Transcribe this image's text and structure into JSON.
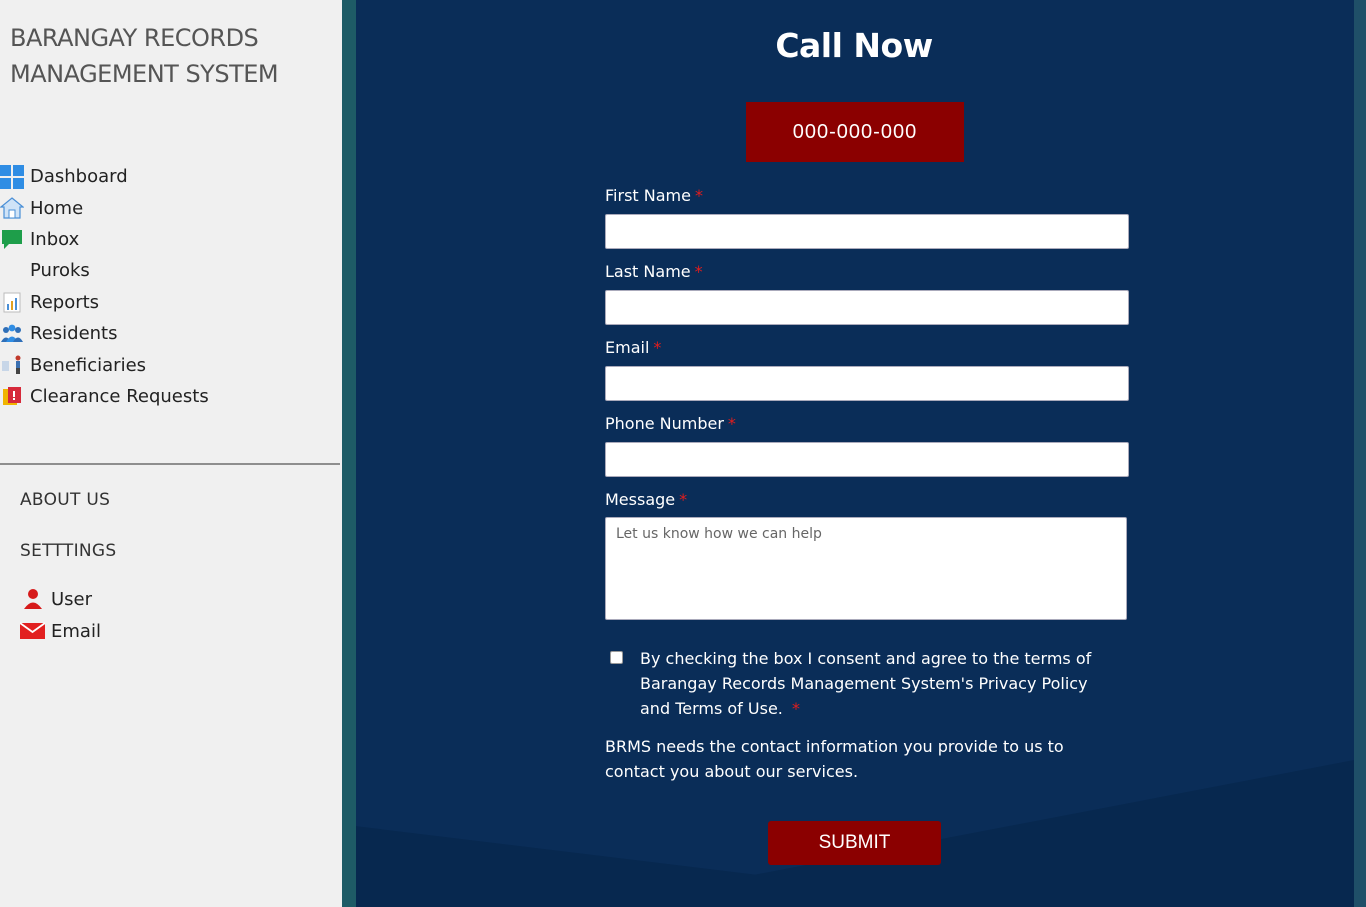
{
  "sidebar": {
    "brand": "BARANGAY RECORDS MANAGEMENT SYSTEM",
    "nav": [
      {
        "label": "Dashboard",
        "icon": "dashboard-icon"
      },
      {
        "label": "Home",
        "icon": "home-icon"
      },
      {
        "label": "Inbox",
        "icon": "chat-icon"
      },
      {
        "label": "Puroks",
        "icon": ""
      },
      {
        "label": "Reports",
        "icon": "reports-icon"
      },
      {
        "label": "Residents",
        "icon": "residents-icon"
      },
      {
        "label": "Beneficiaries",
        "icon": "beneficiaries-icon"
      },
      {
        "label": "Clearance Requests",
        "icon": "clearance-icon"
      }
    ],
    "about": "ABOUT US",
    "settings": "SETTTINGS",
    "sub_items": [
      {
        "label": "User",
        "icon": "user-icon"
      },
      {
        "label": "Email",
        "icon": "email-icon"
      }
    ]
  },
  "main": {
    "title": "Call Now",
    "phone": "000-000-000",
    "fields": [
      {
        "label": "First Name",
        "required": "*",
        "value": ""
      },
      {
        "label": "Last Name",
        "required": "*",
        "value": ""
      },
      {
        "label": "Email",
        "required": "*",
        "value": ""
      },
      {
        "label": "Phone Number",
        "required": "*",
        "value": ""
      }
    ],
    "message": {
      "label": "Message",
      "required": "*",
      "placeholder": "Let us know how we can help"
    },
    "consent": {
      "text": "By checking the box I consent and agree to the terms of Barangay Records Management System's Privacy Policy and Terms of Use.",
      "required": "*",
      "checked": false
    },
    "info": "BRMS needs the contact information you provide to us to contact you about our services.",
    "submit": "SUBMIT"
  },
  "colors": {
    "accent_red": "#8b0000",
    "panel_navy": "#0a2d58",
    "sidebar_bg": "#f0f0f0"
  }
}
